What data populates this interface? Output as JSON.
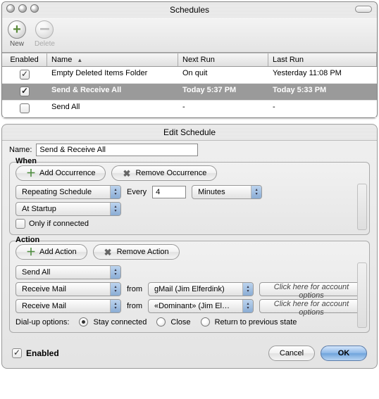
{
  "schedules_window": {
    "title": "Schedules",
    "toolbar": {
      "new_label": "New",
      "delete_label": "Delete"
    },
    "columns": {
      "enabled": "Enabled",
      "name": "Name",
      "next_run": "Next Run",
      "last_run": "Last Run"
    },
    "rows": [
      {
        "enabled": true,
        "name": "Empty Deleted Items Folder",
        "next_run": "On quit",
        "last_run": "Yesterday 11:08 PM",
        "selected": false
      },
      {
        "enabled": true,
        "name": "Send & Receive All",
        "next_run": "Today 5:37 PM",
        "last_run": "Today 5:33 PM",
        "selected": true
      },
      {
        "enabled": false,
        "name": "Send All",
        "next_run": "-",
        "last_run": "-",
        "selected": false
      }
    ]
  },
  "edit_panel": {
    "title": "Edit Schedule",
    "name_label": "Name:",
    "name_value": "Send & Receive All",
    "when": {
      "group_label": "When",
      "add_label": "Add Occurrence",
      "remove_label": "Remove Occurrence",
      "repeating_label": "Repeating Schedule",
      "every_label": "Every",
      "every_value": "4",
      "unit_label": "Minutes",
      "startup_label": "At Startup",
      "only_if_label": "Only if connected",
      "only_if_checked": false
    },
    "action": {
      "group_label": "Action",
      "add_label": "Add Action",
      "remove_label": "Remove Action",
      "rows": [
        {
          "verb": "Send All"
        },
        {
          "verb": "Receive Mail",
          "from_label": "from",
          "account": "gMail (Jim Elferdink)",
          "hint": "Click here for account options"
        },
        {
          "verb": "Receive Mail",
          "from_label": "from",
          "account": "«Dominant» (Jim El…",
          "hint": "Click here for account options"
        }
      ],
      "dialup_label": "Dial-up options:",
      "dialup_options": {
        "stay": "Stay connected",
        "close": "Close",
        "return": "Return to previous state"
      },
      "dialup_selected": "stay"
    },
    "enabled_label": "Enabled",
    "enabled_checked": true,
    "cancel_label": "Cancel",
    "ok_label": "OK"
  }
}
